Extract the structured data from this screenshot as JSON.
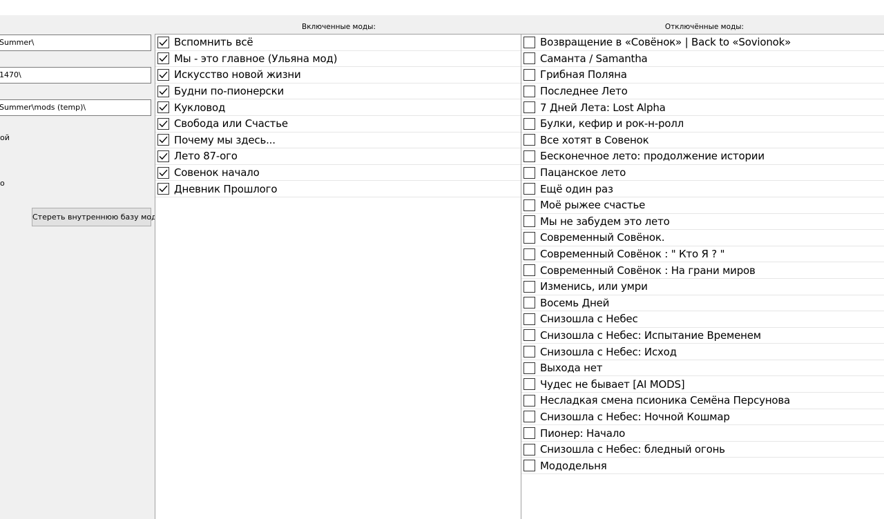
{
  "settings": {
    "path1": "Summer\\",
    "path2": "1470\\",
    "path3": "Summer\\mods (temp)\\",
    "label1": "ой",
    "label2": "о",
    "wipe_button": "Стереть внутреннюю базу модов"
  },
  "enabled": {
    "header": "Включенные моды:",
    "items": [
      "Вспомнить всё",
      "Мы - это главное (Ульяна мод)",
      "Искусство новой жизни",
      "Будни по-пионерски",
      "Кукловод",
      "Свобода или Счастье",
      "Почему мы здесь...",
      "Лето 87-ого",
      "Совенок начало",
      "Дневник Прошлого"
    ]
  },
  "disabled": {
    "header": "Отключённые моды:",
    "items": [
      "Возвращение в «Совёнок» | Back to «Sovionok»",
      "Саманта / Samantha",
      "Грибная Поляна",
      "Последнее Лето",
      "7 Дней Лета: Lost Alpha",
      "Булки, кефир и рок-н-ролл",
      "Все хотят в Совенок",
      "Бесконечное лето: продолжение истории",
      "Пацанское лето",
      "Ещё один раз",
      "Моё рыжее счастье",
      "Мы не забудем это лето",
      "Современный Совёнок.",
      "Современный Совёнок : \" Кто Я ? \"",
      "Современный Совёнок : На грани миров",
      "Изменись, или умри",
      "Восемь Дней",
      "Снизошла с Небес",
      "Снизошла с Небес: Испытание Временем",
      "Снизошла с Небес: Исход",
      "Выхода нет",
      "Чудес не бывает [AI MODS]",
      "Несладкая смена псионика Семёна Персунова",
      "Снизошла с Небес: Ночной Кошмар",
      "Пионер: Начало",
      "Снизошла с Небес: бледный огонь",
      "Мододельня"
    ]
  }
}
